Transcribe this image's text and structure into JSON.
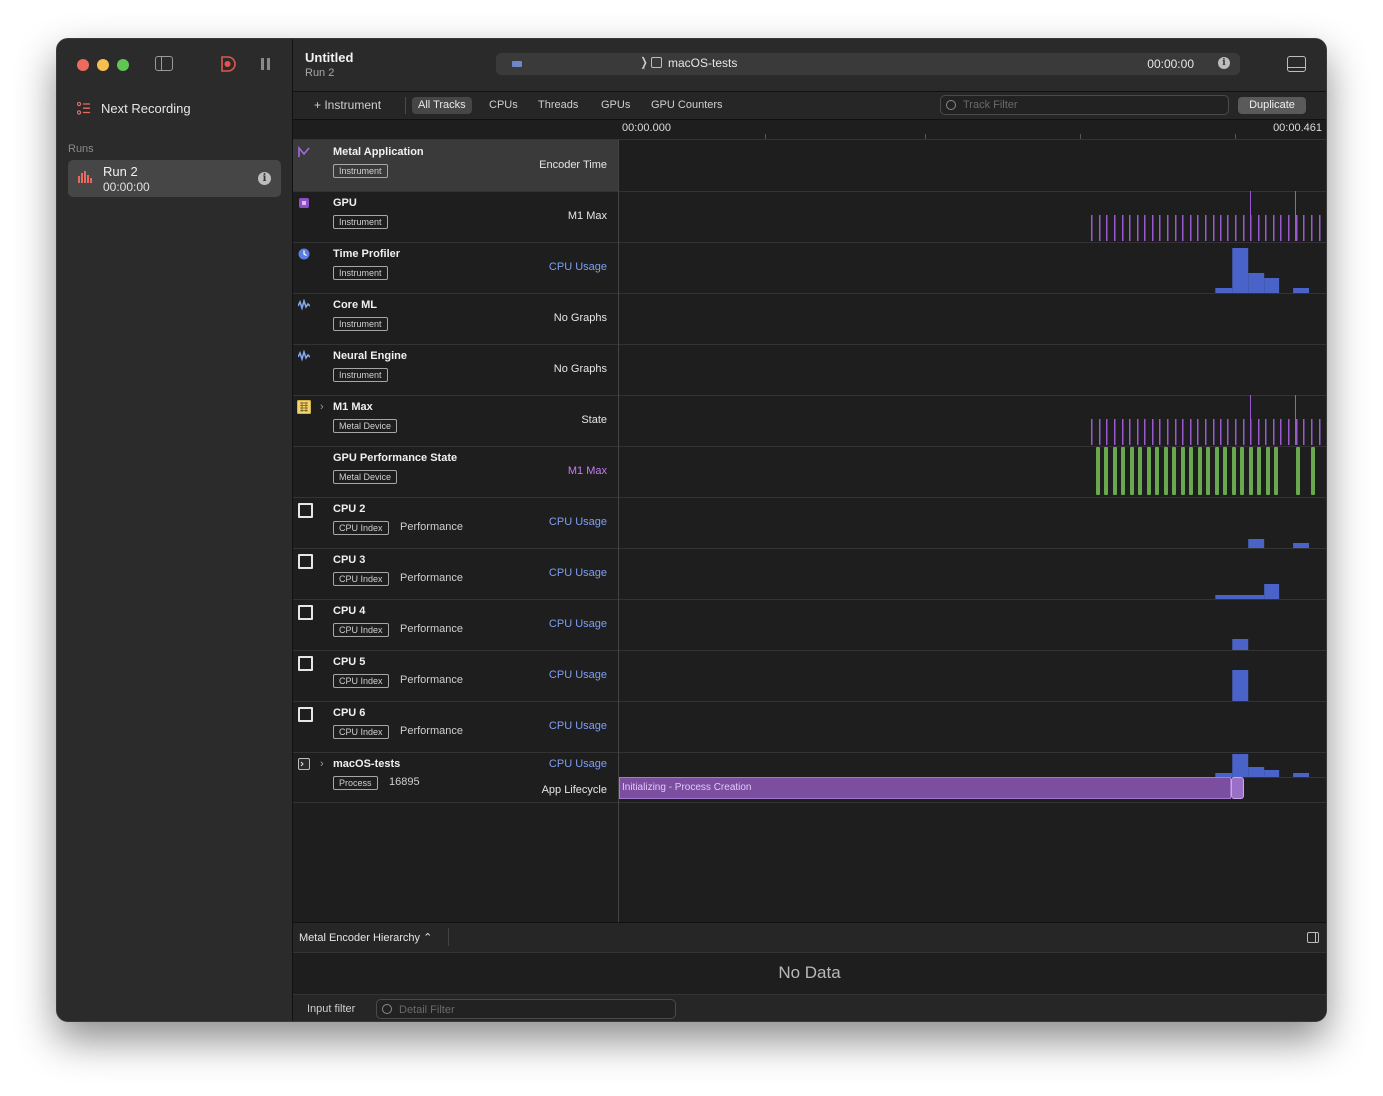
{
  "sidebar": {
    "next_recording": "Next Recording",
    "runs_label": "Runs",
    "run": {
      "title": "Run 2",
      "time": "00:00:00"
    }
  },
  "titlebar": {
    "title": "Untitled",
    "subtitle": "Run 2",
    "target": "macOS-tests",
    "timer": "00:00:00"
  },
  "toolbar": {
    "add_instrument": "+ Instrument",
    "tabs": [
      "All Tracks",
      "CPUs",
      "Threads",
      "GPUs",
      "GPU Counters"
    ],
    "track_filter_placeholder": "Track Filter",
    "duplicate": "Duplicate"
  },
  "ruler": {
    "start": "00:00.000",
    "end": "00:00.461"
  },
  "tracks": [
    {
      "name": "Metal Application",
      "badge": "Instrument",
      "right": "Encoder Time",
      "icon": "metal-icon"
    },
    {
      "name": "GPU",
      "badge": "Instrument",
      "right": "M1 Max",
      "icon": "gpu-icon"
    },
    {
      "name": "Time Profiler",
      "badge": "Instrument",
      "right": "CPU Usage",
      "icon": "time-profiler-icon"
    },
    {
      "name": "Core ML",
      "badge": "Instrument",
      "right": "No Graphs",
      "icon": "coreml-icon"
    },
    {
      "name": "Neural Engine",
      "badge": "Instrument",
      "right": "No Graphs",
      "icon": "neural-engine-icon"
    },
    {
      "name": "M1 Max",
      "badge": "Metal Device",
      "right": "State",
      "icon": "metal-device-icon"
    },
    {
      "name": "GPU Performance State",
      "badge": "Metal Device",
      "right": "M1 Max"
    },
    {
      "name": "CPU 2",
      "badge": "CPU Index",
      "sub": "Performance",
      "right": "CPU Usage"
    },
    {
      "name": "CPU 3",
      "badge": "CPU Index",
      "sub": "Performance",
      "right": "CPU Usage"
    },
    {
      "name": "CPU 4",
      "badge": "CPU Index",
      "sub": "Performance",
      "right": "CPU Usage"
    },
    {
      "name": "CPU 5",
      "badge": "CPU Index",
      "sub": "Performance",
      "right": "CPU Usage"
    },
    {
      "name": "CPU 6",
      "badge": "CPU Index",
      "sub": "Performance",
      "right": "CPU Usage"
    },
    {
      "name": "macOS-tests",
      "badge": "Process",
      "sub": "16895",
      "right": "CPU Usage",
      "right2": "App Lifecycle"
    }
  ],
  "lifecycle_label": "Initializing - Process Creation",
  "detail": {
    "selector": "Metal Encoder Hierarchy ⌃",
    "no_data": "No Data",
    "input_filter": "Input filter",
    "detail_filter_placeholder": "Detail Filter"
  },
  "colors": {
    "purple": "#9b59d0",
    "blue": "#4a63c8",
    "green": "#6aa84f"
  }
}
